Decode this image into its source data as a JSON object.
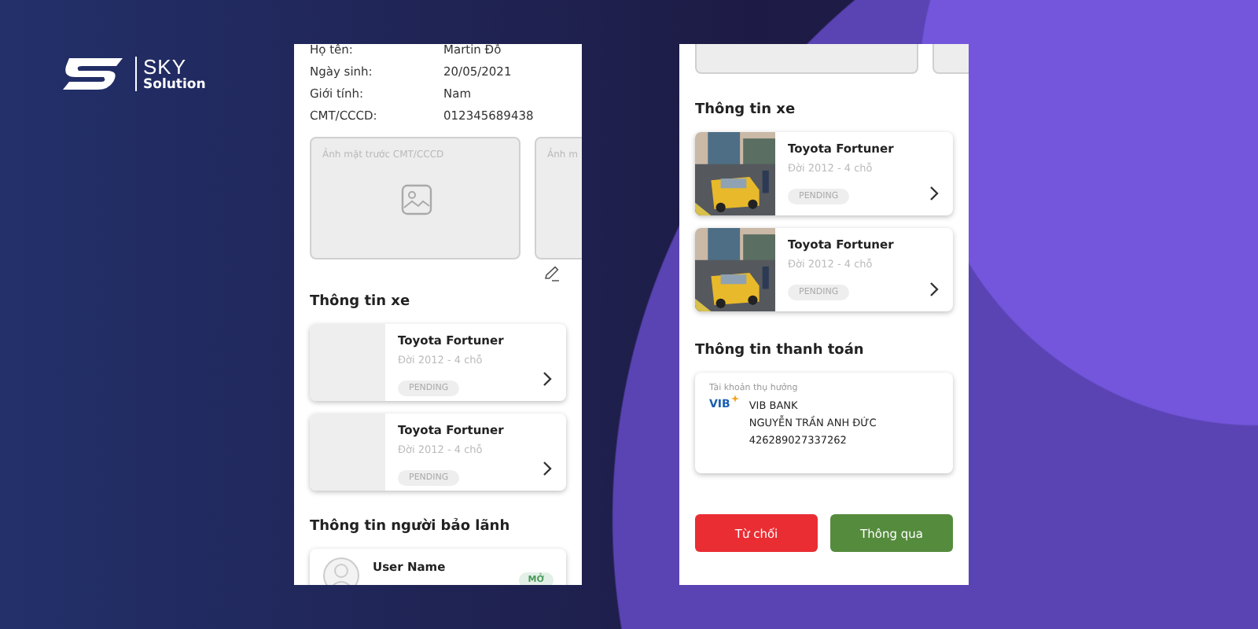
{
  "brand": {
    "name": "SKY",
    "tagline": "Solution"
  },
  "screens": [
    {
      "profile": [
        {
          "label": "Họ tên:",
          "value": "Martin Đỗ"
        },
        {
          "label": "Ngày sinh:",
          "value": "20/05/2021"
        },
        {
          "label": "Giới tính:",
          "value": "Nam"
        },
        {
          "label": "CMT/CCCD:",
          "value": "012345689438"
        }
      ],
      "id_photos": [
        {
          "caption": "Ảnh mặt trước CMT/CCCD"
        },
        {
          "caption": "Ảnh m"
        }
      ],
      "vehicles_title": "Thông tin xe",
      "vehicles": [
        {
          "name": "Toyota Fortuner",
          "detail": "Đời 2012 - 4 chỗ",
          "status": "PENDING",
          "kind": "placeholder"
        },
        {
          "name": "Toyota Fortuner",
          "detail": "Đời 2012 - 4 chỗ",
          "status": "PENDING",
          "kind": "placeholder"
        }
      ],
      "guarantor_title": "Thông tin người bảo lãnh",
      "guarantor": {
        "name": "User Name",
        "badge": "MỞ"
      }
    },
    {
      "vehicles_title": "Thông tin xe",
      "vehicles": [
        {
          "name": "Toyota Fortuner",
          "detail": "Đời 2012 - 4 chỗ",
          "status": "PENDING",
          "kind": "picture"
        },
        {
          "name": "Toyota Fortuner",
          "detail": "Đời 2012 - 4 chỗ",
          "status": "PENDING",
          "kind": "picture"
        }
      ],
      "payment": {
        "title": "Thông tin thanh toán",
        "label": "Tài khoản thụ hưởng",
        "bank_logo": "VIB",
        "bank": "VIB BANK",
        "holder": "NGUYỄN TRẦN ANH ĐỨC",
        "account": "426289027337262"
      },
      "actions": [
        {
          "label": "Từ chối",
          "kind": "reject"
        },
        {
          "label": "Thông qua",
          "kind": "approve"
        }
      ]
    }
  ]
}
